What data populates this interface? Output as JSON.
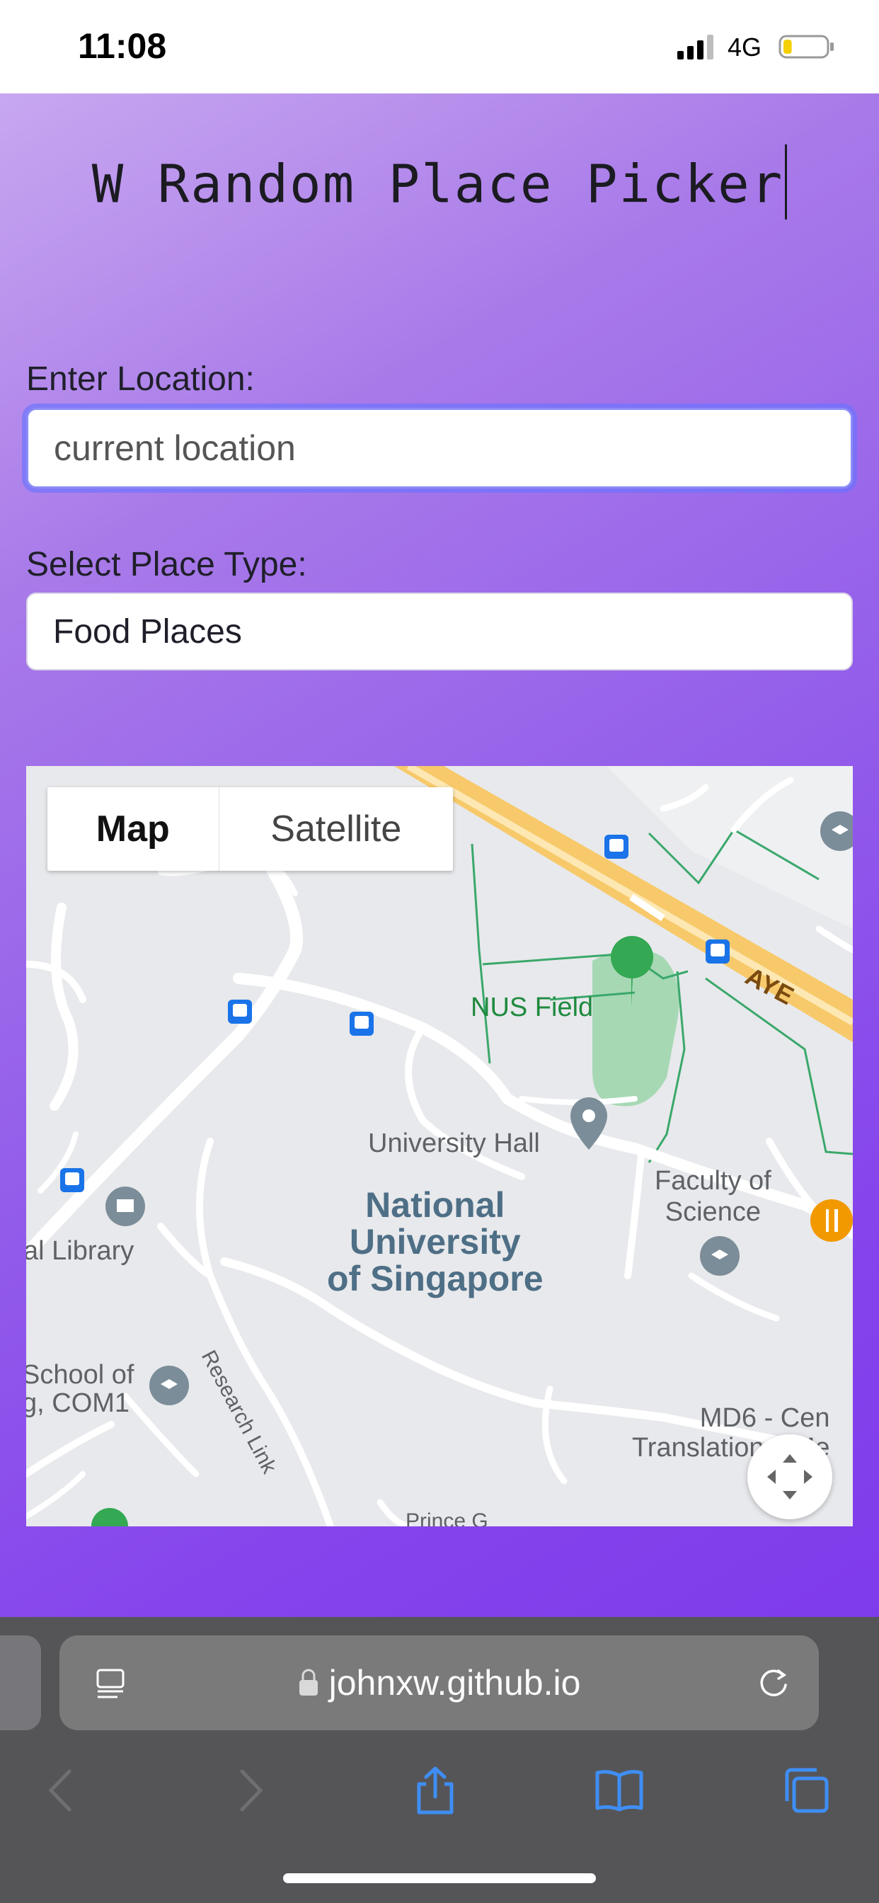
{
  "status_bar": {
    "time": "11:08",
    "network": "4G",
    "battery_level": 0.2,
    "battery_color": "#f5d000"
  },
  "app": {
    "title": "W Random Place Picker",
    "location_label": "Enter Location:",
    "location_value": "current location",
    "type_label": "Select Place Type:",
    "type_value": "Food Places",
    "accent": "#7a35ea"
  },
  "map": {
    "toggle_map": "Map",
    "toggle_satellite": "Satellite",
    "labels": {
      "nus_field": "NUS Field",
      "aye": "AYE",
      "university_hall": "University Hall",
      "faculty_science": "Faculty of\nScience",
      "national_university": "National\nUniversity\nof Singapore",
      "library": "al Library",
      "research_link": "Research Link",
      "school_computing": "School of\ng, COM1",
      "md6": "MD6 - Cen\nTranslational Me",
      "prince": "Prince G"
    },
    "icons": [
      "bus-stop-icon",
      "park-icon",
      "place-pin-icon",
      "school-icon",
      "library-icon",
      "restaurant-icon",
      "fullscreen-icon"
    ]
  },
  "browser": {
    "url": "johnxw.github.io",
    "buttons": [
      "back",
      "forward",
      "share",
      "bookmarks",
      "tabs"
    ]
  }
}
